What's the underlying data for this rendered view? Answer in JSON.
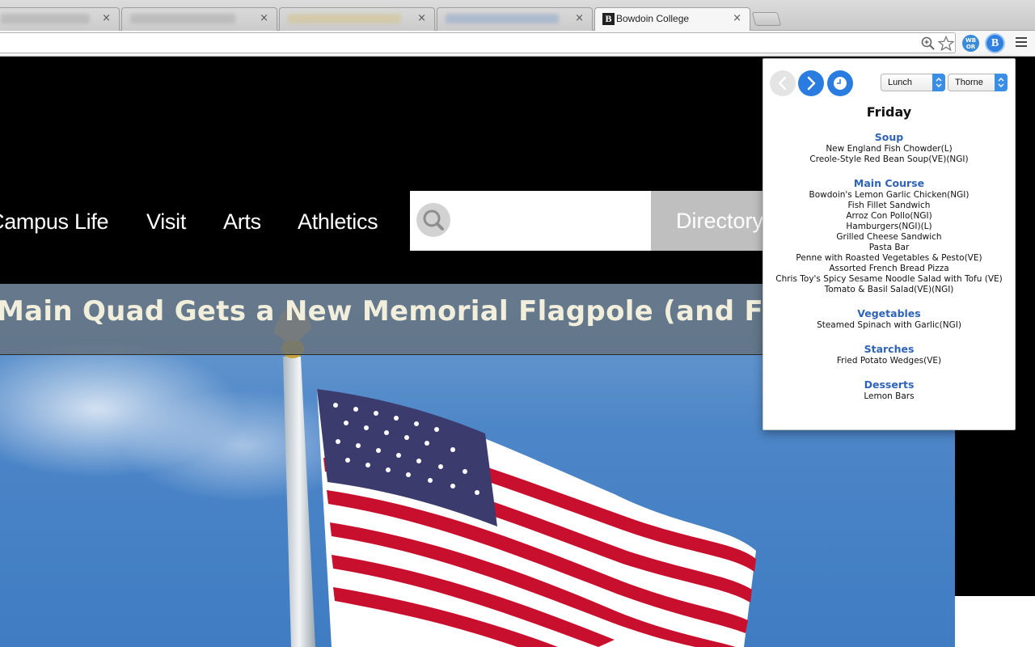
{
  "browser": {
    "tabs": [
      {
        "label": "",
        "close": "×",
        "active": false
      },
      {
        "label": "",
        "close": "×",
        "active": false
      },
      {
        "label": "",
        "close": "×",
        "active": false
      },
      {
        "label": "",
        "close": "×",
        "active": false
      },
      {
        "label": "Bowdoin College",
        "favicon": "B",
        "close": "×",
        "active": true
      }
    ],
    "extension_wb_label": "WB\nOR",
    "extension_b_label": "B"
  },
  "site": {
    "nav": [
      "Campus Life",
      "Visit",
      "Arts",
      "Athletics"
    ],
    "search_placeholder": "",
    "directory_label": "Directory",
    "headline": "Main Quad Gets a New Memorial Flagpole (and Flag)"
  },
  "popup": {
    "meal": "Lunch",
    "hall": "Thorne",
    "day": "Friday",
    "accent_color": "#2a7ce0",
    "sections": [
      {
        "title": "Soup",
        "items": [
          "New England Fish Chowder(L)",
          "Creole-Style Red Bean Soup(VE)(NGI)"
        ]
      },
      {
        "title": "Main Course",
        "items": [
          "Bowdoin's Lemon Garlic Chicken(NGI)",
          "Fish Fillet Sandwich",
          "Arroz Con Pollo(NGI)",
          "Hamburgers(NGI)(L)",
          "Grilled Cheese Sandwich",
          "Pasta Bar",
          "Penne with Roasted Vegetables & Pesto(VE)",
          "Assorted French Bread Pizza",
          "Chris Toy's Spicy Sesame Noodle Salad with Tofu (VE)",
          "Tomato & Basil Salad(VE)(NGI)"
        ]
      },
      {
        "title": "Vegetables",
        "items": [
          "Steamed Spinach with Garlic(NGI)"
        ]
      },
      {
        "title": "Starches",
        "items": [
          "Fried Potato Wedges(VE)"
        ]
      },
      {
        "title": "Desserts",
        "items": [
          "Lemon Bars"
        ]
      }
    ]
  }
}
